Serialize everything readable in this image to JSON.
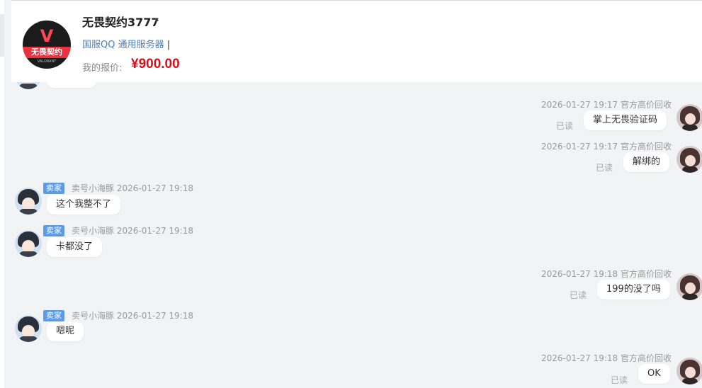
{
  "product": {
    "logo_brand": "无畏契约",
    "logo_sub": "VALORANT",
    "title": "无畏契约3777",
    "title_arrow": "›",
    "server": "国服QQ 通用服务器",
    "server_sep": "|",
    "price_label": "我的报价:",
    "price": "¥900.00"
  },
  "messages": [
    {
      "side": "right",
      "sender": "官方高价回收",
      "time": "2026-01-27 19:17",
      "text": "掌上无畏验证码",
      "status": "已读"
    },
    {
      "side": "right",
      "sender": "官方高价回收",
      "time": "2026-01-27 19:17",
      "text": "解绑的",
      "status": "已读"
    },
    {
      "side": "left",
      "tag": "卖家",
      "sender": "卖号小海豚",
      "time": "2026-01-27 19:18",
      "text": "这个我整不了"
    },
    {
      "side": "left",
      "tag": "卖家",
      "sender": "卖号小海豚",
      "time": "2026-01-27 19:18",
      "text": "卡都没了"
    },
    {
      "side": "right",
      "sender": "官方高价回收",
      "time": "2026-01-27 19:18",
      "text": "199的没了吗",
      "status": "已读"
    },
    {
      "side": "left",
      "tag": "卖家",
      "sender": "卖号小海豚",
      "time": "2026-01-27 19:18",
      "text": "嗯呢"
    },
    {
      "side": "right",
      "sender": "官方高价回收",
      "time": "2026-01-27 19:18",
      "text": "OK",
      "status": "已读"
    }
  ],
  "colors": {
    "background": "#f2f3f5",
    "price": "#d9101c",
    "seller_tag": "#5b9be8",
    "server_link": "#4a7fc1"
  }
}
